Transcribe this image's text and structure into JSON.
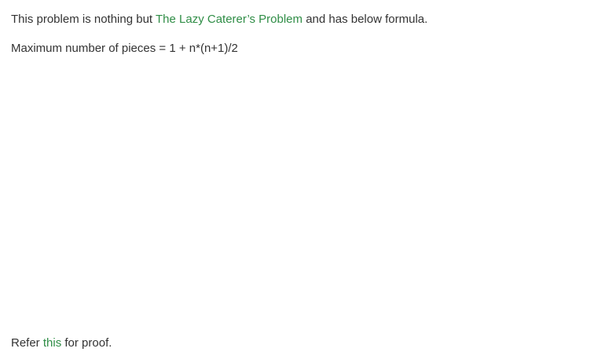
{
  "intro": {
    "before": "This problem is nothing but ",
    "link": "The Lazy Caterer’s Problem",
    "after": " and has below formula."
  },
  "formula": "Maximum number of pieces = 1 + n*(n+1)/2",
  "proof": {
    "before": "Refer ",
    "link": "this",
    "after": " for proof."
  },
  "colors": {
    "link": "#2f8d46",
    "text": "#333333"
  }
}
